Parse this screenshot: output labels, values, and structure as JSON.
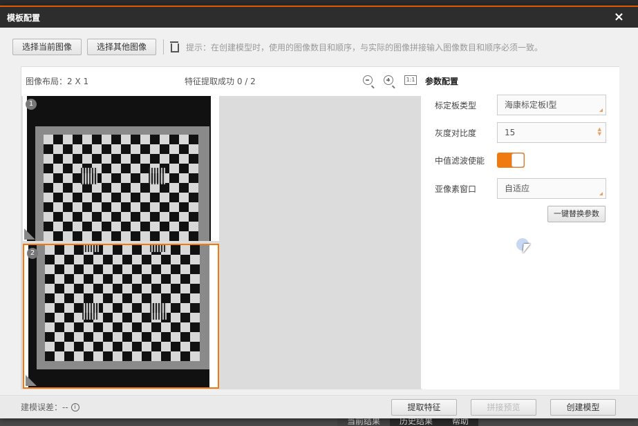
{
  "dialog": {
    "title": "模板配置",
    "close_icon": "×"
  },
  "toolbar": {
    "select_current_label": "选择当前图像",
    "select_other_label": "选择其他图像",
    "hint": "提示：在创建模型时，使用的图像数目和顺序，与实际的图像拼接输入图像数目和顺序必须一致。"
  },
  "image_panel": {
    "layout_label": "图像布局：2 X 1",
    "feature_label": "特征提取成功 0 / 2",
    "fit_icon_text": "1:1",
    "images": [
      {
        "index": "1"
      },
      {
        "index": "2"
      }
    ]
  },
  "params": {
    "title": "参数配置",
    "rows": [
      {
        "label": "标定板类型",
        "value": "海康标定板I型"
      },
      {
        "label": "灰度对比度",
        "value": "15"
      },
      {
        "label": "中值滤波使能",
        "enabled": true
      },
      {
        "label": "亚像素窗口",
        "value": "自适应"
      }
    ],
    "replace_button": "一键替换参数"
  },
  "footer": {
    "error_label": "建模误差：--",
    "info_icon": "i",
    "extract_button": "提取特征",
    "preview_button": "拼接预览",
    "create_button": "创建模型"
  },
  "background_tabs": [
    "当前结果",
    "历史结果",
    "帮助"
  ],
  "colors": {
    "accent": "#f07a10",
    "titlebar": "#2d2d2d"
  }
}
